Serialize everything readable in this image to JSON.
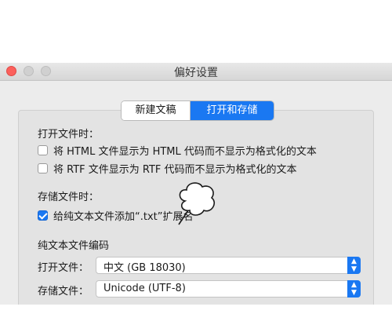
{
  "window": {
    "title": "偏好设置"
  },
  "tabs": [
    {
      "label": "新建文稿",
      "active": false
    },
    {
      "label": "打开和存储",
      "active": true
    }
  ],
  "open_section": {
    "title": "打开文件时：",
    "options": [
      {
        "label": "将 HTML 文件显示为 HTML 代码而不显示为格式化的文本",
        "checked": false
      },
      {
        "label": "将 RTF 文件显示为 RTF 代码而不显示为格式化的文本",
        "checked": false
      }
    ]
  },
  "save_section": {
    "title": "存储文件时：",
    "options": [
      {
        "label": "给纯文本文件添加“.txt”扩展名",
        "checked": true
      }
    ]
  },
  "encoding_section": {
    "title": "纯文本文件编码",
    "open_label": "打开文件：",
    "open_value": "中文 (GB 18030)",
    "save_label": "存储文件：",
    "save_value": "Unicode (UTF-8)"
  },
  "colors": {
    "accent": "#1a78f2",
    "close_button": "#fc605c"
  }
}
